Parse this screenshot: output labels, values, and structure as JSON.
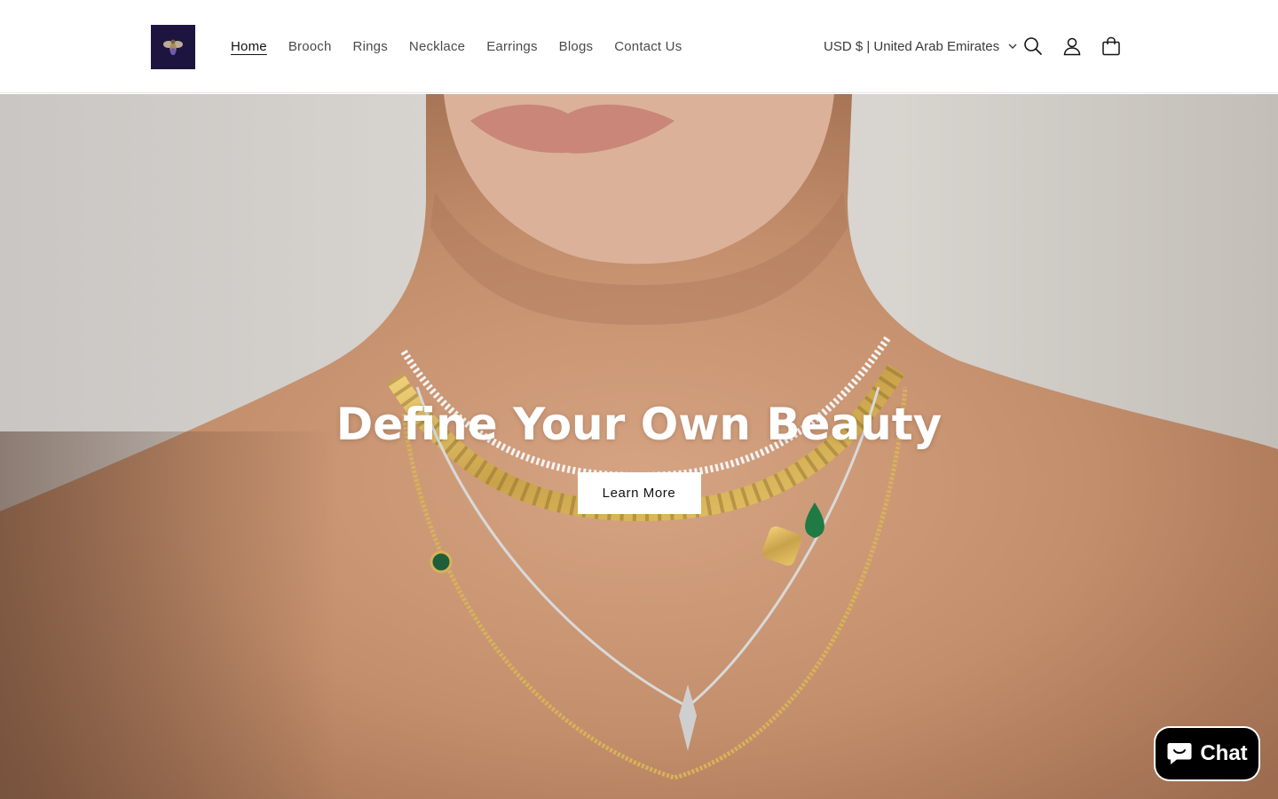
{
  "brand": {
    "logo_icon": "bee-icon",
    "logo_bg": "#1d1540"
  },
  "nav": {
    "items": [
      {
        "label": "Home",
        "active": true
      },
      {
        "label": "Brooch"
      },
      {
        "label": "Rings"
      },
      {
        "label": "Necklace"
      },
      {
        "label": "Earrings"
      },
      {
        "label": "Blogs"
      },
      {
        "label": "Contact Us"
      }
    ]
  },
  "locale": {
    "label": "USD $ | United Arab Emirates",
    "icon": "chevron-down-icon"
  },
  "header_icons": [
    "search-icon",
    "account-icon",
    "cart-icon"
  ],
  "hero": {
    "title": "Define Your Own Beauty",
    "button_label": "Learn More"
  },
  "chat": {
    "label": "Chat",
    "icon": "chat-bubble-icon",
    "bg": "#000000"
  }
}
